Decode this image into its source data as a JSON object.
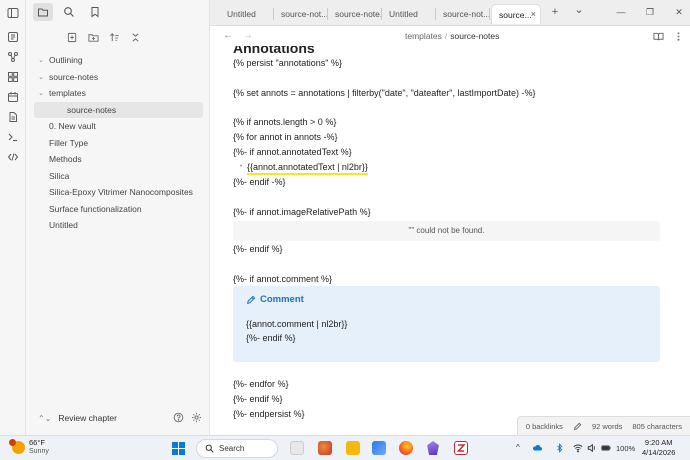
{
  "tabs": [
    {
      "label": "Untitled"
    },
    {
      "label": "source-not..."
    },
    {
      "label": "source-note..."
    },
    {
      "label": "Untitled"
    },
    {
      "label": "source-not..."
    },
    {
      "label": "source..."
    }
  ],
  "tab_controls": {
    "close": "×",
    "new_tab": "+",
    "dropdown": "⌄",
    "minimize": "—",
    "restore": "❐",
    "close_window": "✕"
  },
  "breadcrumb": {
    "folder": "templates",
    "separator": "/",
    "file": "source-notes"
  },
  "nav": {
    "back": "←",
    "forward": "→"
  },
  "file_tree": [
    {
      "label": "Outlining",
      "chevron": "⌄"
    },
    {
      "label": "source-notes",
      "chevron": "⌄"
    },
    {
      "label": "templates",
      "chevron": "⌄"
    },
    {
      "label": "source-notes",
      "chevron": ""
    },
    {
      "label": "0. New vault",
      "chevron": ""
    },
    {
      "label": "Filler Type",
      "chevron": ""
    },
    {
      "label": "Methods",
      "chevron": ""
    },
    {
      "label": "Silica",
      "chevron": ""
    },
    {
      "label": "Silica-Epoxy Vitrimer Nanocomposites",
      "chevron": ""
    },
    {
      "label": "Surface functionalization",
      "chevron": ""
    },
    {
      "label": "Untitled",
      "chevron": ""
    }
  ],
  "sidebar_bottom": {
    "chevrons": "⌃⌄",
    "vault_name": "Review chapter"
  },
  "editor": {
    "heading": "Annotations",
    "lines": {
      "persist": "{% persist \"annotations\" %}",
      "set": "{% set annots = annotations | filterby(\"date\", \"dateafter\", lastImportDate) -%}",
      "if_length": "{% if annots.length > 0 %}",
      "for": "{% for annot in annots -%}",
      "if_text": "{%- if annot.annotatedText %}",
      "bullet": "•",
      "text_expr": "{{annot.annotatedText | nl2br}}",
      "endif1": "{%- endif -%}",
      "if_image": "{%- if annot.imageRelativePath %}",
      "endif2": "{%- endif %}",
      "if_comment": "{%- if annot.comment %}",
      "endfor": "{%- endfor %}",
      "endif3": "{%- endif %}",
      "endpersist": "{%- endpersist %}"
    },
    "embed_message": "\"\" could not be found.",
    "callout": {
      "title": "Comment",
      "line1": "{{annot.comment | nl2br}}",
      "line2": "{%- endif %}"
    }
  },
  "status": {
    "backlinks": "0 backlinks",
    "words": "92 words",
    "characters": "805 characters"
  },
  "taskbar": {
    "weather_temp": "66°F",
    "weather_cond": "Sunny",
    "search_label": "Search",
    "battery": "100%",
    "time": "9:20 AM",
    "date": "4/14/2026",
    "tray_chevron": "^"
  },
  "colors": {
    "accent_blue": "#1e6fc2",
    "highlight_yellow": "#f2ea1b",
    "callout_bg": "#e6f0fb"
  }
}
